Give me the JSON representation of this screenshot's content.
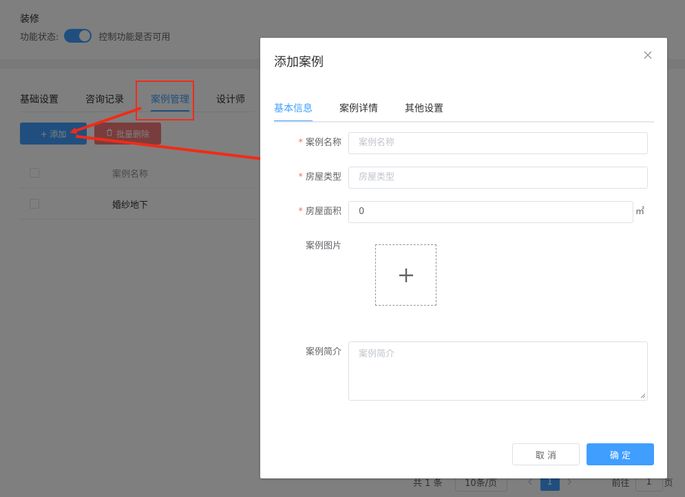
{
  "page": {
    "section_title": "装修",
    "status_label": "功能状态:",
    "status_hint": "控制功能是否可用",
    "tabs": [
      {
        "label": "基础设置"
      },
      {
        "label": "咨询记录"
      },
      {
        "label": "案例管理"
      },
      {
        "label": "设计师"
      }
    ],
    "add_button": "+ 添加",
    "batch_delete_button": "批量删除",
    "table": {
      "header": "案例名称",
      "rows": [
        {
          "name": "婚纱地下"
        }
      ]
    },
    "pagination": {
      "total": "共 1 条",
      "page_size": "10条/页",
      "current": "1",
      "goto_label": "前往",
      "goto_value": "1",
      "goto_suffix": "页"
    }
  },
  "dialog": {
    "title": "添加案例",
    "tabs": [
      {
        "label": "基本信息"
      },
      {
        "label": "案例详情"
      },
      {
        "label": "其他设置"
      }
    ],
    "fields": {
      "name": {
        "label": "案例名称",
        "placeholder": "案例名称",
        "required": "*"
      },
      "house_type": {
        "label": "房屋类型",
        "placeholder": "房屋类型",
        "required": "*"
      },
      "area": {
        "label": "房屋面积",
        "value": "0",
        "unit": "㎡",
        "required": "*"
      },
      "image": {
        "label": "案例图片"
      },
      "intro": {
        "label": "案例简介",
        "placeholder": "案例简介"
      }
    },
    "cancel_button": "取 消",
    "confirm_button": "确 定"
  },
  "colors": {
    "primary": "#409eff",
    "danger": "#f56c6c",
    "annotation": "#f02b18"
  },
  "icons": {
    "close": "close-icon",
    "plus": "plus-icon",
    "delete": "trash-icon"
  }
}
